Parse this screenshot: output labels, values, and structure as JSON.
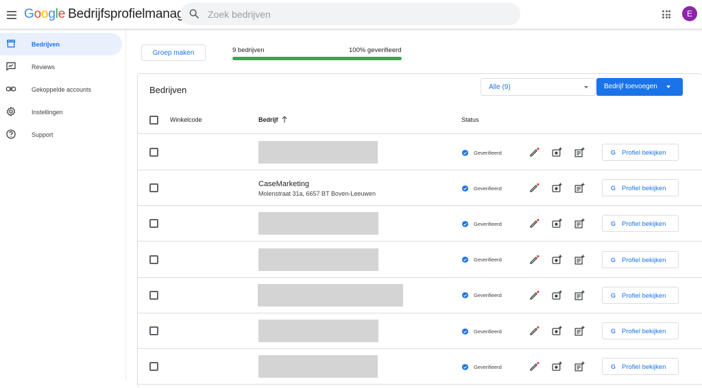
{
  "header": {
    "logo_parts": [
      "G",
      "o",
      "o",
      "g",
      "l",
      "e"
    ],
    "product": "Bedrijfsprofielmanager",
    "search_placeholder": "Zoek bedrijven",
    "avatar_letter": "E",
    "avatar_color": "#8e24aa"
  },
  "sidebar": {
    "items": [
      {
        "label": "Bedrijven",
        "icon": "storefront-icon",
        "active": true
      },
      {
        "label": "Reviews",
        "icon": "review-icon",
        "active": false
      },
      {
        "label": "Gekoppelde accounts",
        "icon": "link-icon",
        "active": false
      },
      {
        "label": "Instellingen",
        "icon": "gear-icon",
        "active": false
      },
      {
        "label": "Support",
        "icon": "help-icon",
        "active": false
      }
    ]
  },
  "toolbar": {
    "group_button": "Groep maken",
    "count_label": "9 bedrijven",
    "verified_label": "100% geverifieerd",
    "verified_fraction": 1.0,
    "progress_color": "#34a853"
  },
  "card": {
    "title": "Bedrijven",
    "filter_value": "Alle (9)",
    "add_button": "Bedrijf toevoegen",
    "columns": {
      "code": "Winkelcode",
      "business": "Bedrijf",
      "status": "Status"
    }
  },
  "rows": [
    {
      "name": "",
      "address": "",
      "status": "Geverifieerd",
      "profile_button": "Profiel bekijken"
    },
    {
      "name": "CaseMarketing",
      "address": "Molenstraat 31a, 6657 BT Boven-Leeuwen",
      "status": "Geverifieerd",
      "profile_button": "Profiel bekijken"
    },
    {
      "name": "",
      "address": "",
      "status": "Geverifieerd",
      "profile_button": "Profiel bekijken"
    },
    {
      "name": "",
      "address": "",
      "status": "Geverifieerd",
      "profile_button": "Profiel bekijken"
    },
    {
      "name": "",
      "address": "",
      "status": "Geverifieerd",
      "profile_button": "Profiel bekijken"
    },
    {
      "name": "",
      "address": "",
      "status": "Geverifieerd",
      "profile_button": "Profiel bekijken"
    },
    {
      "name": "",
      "address": "",
      "status": "Geverifieerd",
      "profile_button": "Profiel bekijken"
    }
  ],
  "colors": {
    "accent": "#1a73e8",
    "verified": "#1a73e8",
    "placeholder": "#d4d4d4"
  }
}
